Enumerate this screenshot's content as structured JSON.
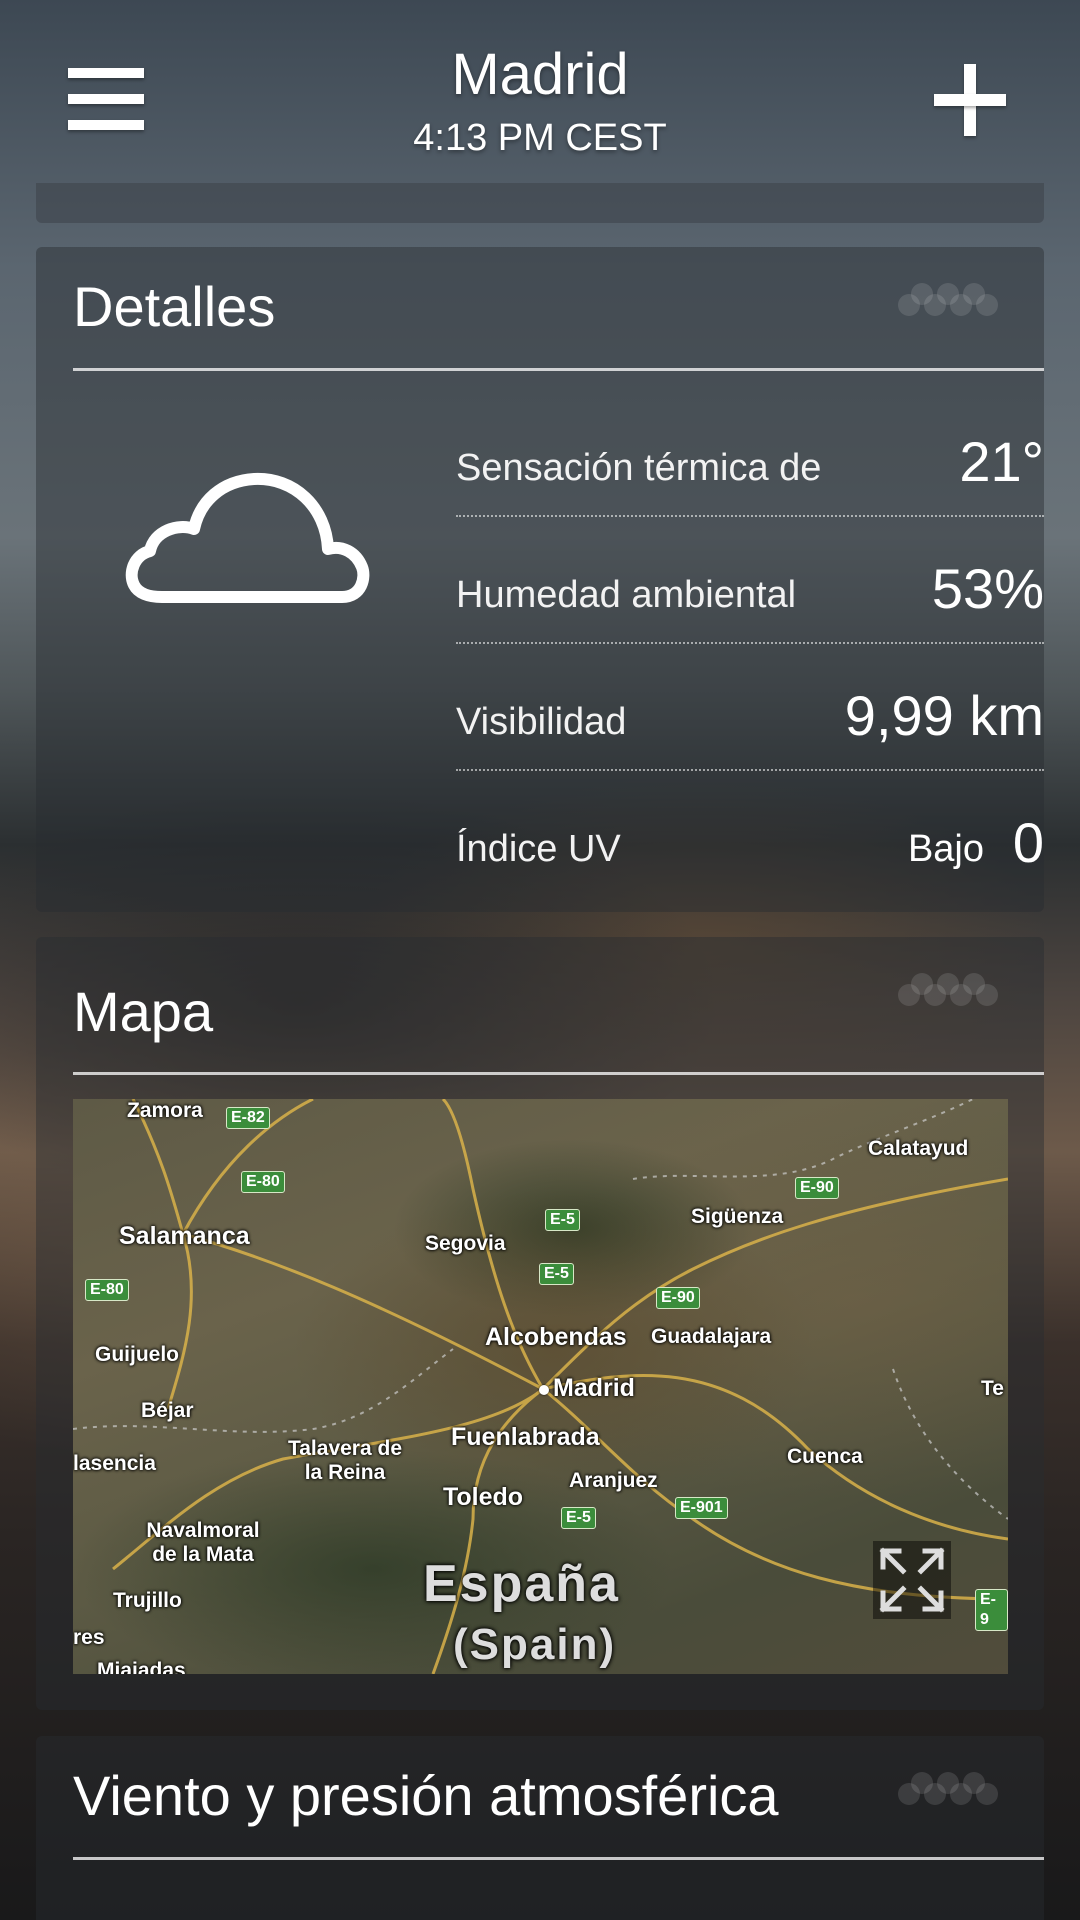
{
  "header": {
    "city": "Madrid",
    "time": "4:13 PM CEST",
    "menu_icon": "hamburger-menu-icon",
    "add_icon": "plus-icon"
  },
  "details": {
    "title": "Detalles",
    "condition_icon": "cloud-icon",
    "rows": [
      {
        "label": "Sensación térmica de",
        "value": "21°"
      },
      {
        "label": "Humedad ambiental",
        "value": "53%"
      },
      {
        "label": "Visibilidad",
        "value": "9,99 km"
      },
      {
        "label": "Índice UV",
        "level": "Bajo",
        "value": "0"
      }
    ]
  },
  "map": {
    "title": "Mapa",
    "places": [
      "Zamora",
      "Calatayud",
      "Salamanca",
      "Sigüenza",
      "Segovia",
      "Alcobendas",
      "Guadalajara",
      "Guijuelo",
      "Madrid",
      "Te",
      "Béjar",
      "Talavera de la Reina",
      "Fuenlabrada",
      "lasencia",
      "Cuenca",
      "Aranjuez",
      "Toledo",
      "Navalmoral de la Mata",
      "Trujillo",
      "res",
      "Miajadas"
    ],
    "roads": [
      "E-82",
      "E-80",
      "E-90",
      "E-5",
      "E-5",
      "E-80",
      "E-90",
      "E-901",
      "E-5",
      "E-9"
    ],
    "country": "España",
    "country_alt": "(Spain)",
    "expand_icon": "fullscreen-expand-icon"
  },
  "wind": {
    "title": "Viento y presión atmosférica"
  }
}
